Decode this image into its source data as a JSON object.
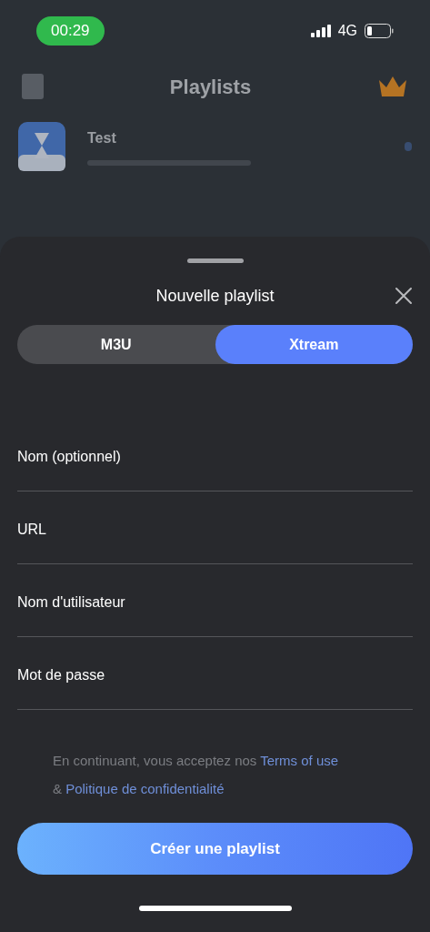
{
  "status_bar": {
    "time": "00:29",
    "network": "4G"
  },
  "background": {
    "title": "Playlists",
    "playlists": [
      {
        "name": "Test"
      }
    ]
  },
  "sheet": {
    "title": "Nouvelle playlist",
    "tabs": [
      {
        "label": "M3U",
        "selected": false
      },
      {
        "label": "Xtream",
        "selected": true
      }
    ],
    "fields": [
      {
        "placeholder": "Nom (optionnel)"
      },
      {
        "placeholder": "URL"
      },
      {
        "placeholder": "Nom d'utilisateur"
      },
      {
        "placeholder": "Mot de passe"
      }
    ],
    "legal": {
      "prefix": "En continuant, vous acceptez nos",
      "terms_link": "Terms of use",
      "joiner": "&",
      "privacy_link": "Politique de confidentialité"
    },
    "submit": "Créer une playlist"
  }
}
